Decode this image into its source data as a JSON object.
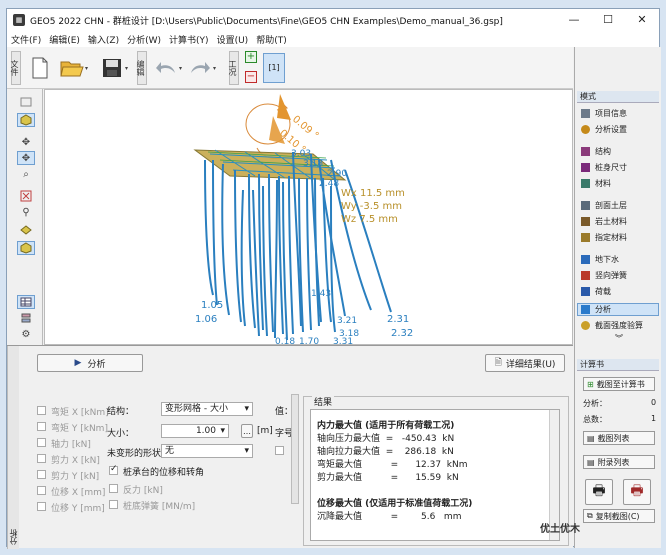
{
  "window": {
    "title": "GEO5 2022 CHN - 群桩设计 [D:\\Users\\Public\\Documents\\Fine\\GEO5 CHN Examples\\Demo_manual_36.gsp]",
    "minimize": "—",
    "maximize": "☐",
    "close": "✕"
  },
  "menu": [
    "文件(F)",
    "编辑(E)",
    "输入(Z)",
    "分析(W)",
    "计算书(Y)",
    "设置(U)",
    "帮助(T)"
  ],
  "toolbar": {
    "file_label": "文件",
    "edit_label": "编辑",
    "stage_label": "工况",
    "stage_current": "[1]",
    "plus": "+",
    "minus": "−"
  },
  "canvas": {
    "rotation_labels": [
      "0.09 °",
      "0.10 °"
    ],
    "displacements": [
      "Wx 11.5 mm",
      "Wy -3.5 mm",
      "Wz 7.5 mm"
    ],
    "left_values": [
      "1.05",
      "1.06"
    ],
    "right_values": [
      "2.31",
      "2.32"
    ],
    "mid_values": [
      "1.43",
      "3.21",
      "3.18",
      "3.31",
      "1.70",
      "0.18"
    ],
    "top_values": [
      "3.03",
      "3.18",
      "2.90",
      "2.48"
    ]
  },
  "bottom": {
    "vtab": "分析",
    "analyze_button": "分析",
    "details_button": "详细结果(U)",
    "left_checks": [
      {
        "label": "弯矩 X [kNm]",
        "checked": false
      },
      {
        "label": "弯矩 Y [kNm]",
        "checked": false
      },
      {
        "label": "轴力 [kN]",
        "checked": false
      },
      {
        "label": "剪力 X [kN]",
        "checked": false
      },
      {
        "label": "剪力 Y [kN]",
        "checked": false
      },
      {
        "label": "位移 X [mm]",
        "checked": false
      },
      {
        "label": "位移 Y [mm]",
        "checked": false
      }
    ],
    "structure_label": "结构：",
    "structure_value": "变形网格 - 大小",
    "size_label": "大小：",
    "size_value": "1.00",
    "size_unit": "[m]",
    "font_label": "字号",
    "value_label": "值：",
    "undeformed_label": "未变形的形状：",
    "undeformed_value": "无",
    "cap_check": "桩承台的位移和转角",
    "reaction_check": "反力 [kN]",
    "spring_check": "桩底弹簧 [MN/m]",
    "results_title": "结果",
    "results_rows": [
      "内力最大值 (适用于所有荷载工况)",
      "轴向压力最大值  =   -450.43  kN",
      "轴向拉力最大值  =    286.18  kN",
      "弯矩最大值          =      12.37  kNm",
      "剪力最大值          =      15.59  kN",
      "",
      "位移最大值 (仅适用于标准值荷载工况)",
      "沉降最大值          =        5.6   mm"
    ]
  },
  "right_panel": {
    "mode_header": "模式",
    "items": [
      {
        "label": "项目信息",
        "color": "#6c7a8a"
      },
      {
        "label": "分析设置",
        "color": "#c58a1a"
      },
      {
        "label": "结构",
        "color": "#8a3a7a"
      },
      {
        "label": "桩身尺寸",
        "color": "#7a2a7a"
      },
      {
        "label": "材料",
        "color": "#3a7a6a"
      },
      {
        "label": "剖面土层",
        "color": "#5a6a7a"
      },
      {
        "label": "岩土材料",
        "color": "#7a5a2a"
      },
      {
        "label": "指定材料",
        "color": "#9a7a2a"
      },
      {
        "label": "地下水",
        "color": "#2a6aba"
      },
      {
        "label": "竖向弹簧",
        "color": "#ba3a2a"
      },
      {
        "label": "荷载",
        "color": "#2a5aaa"
      },
      {
        "label": "分析",
        "color": "#2a7acb"
      },
      {
        "label": "截面强度验算",
        "color": "#caa02a"
      }
    ],
    "report_header": "计算书",
    "add_report": "截图至计算书",
    "analysis_label": "分析：",
    "analysis_count": "0",
    "total_label": "总数：",
    "total_count": "1",
    "section_list": "截图列表",
    "appendix_list": "附录列表",
    "copy_view": "复制截图(C)"
  },
  "watermark": "优土优木"
}
